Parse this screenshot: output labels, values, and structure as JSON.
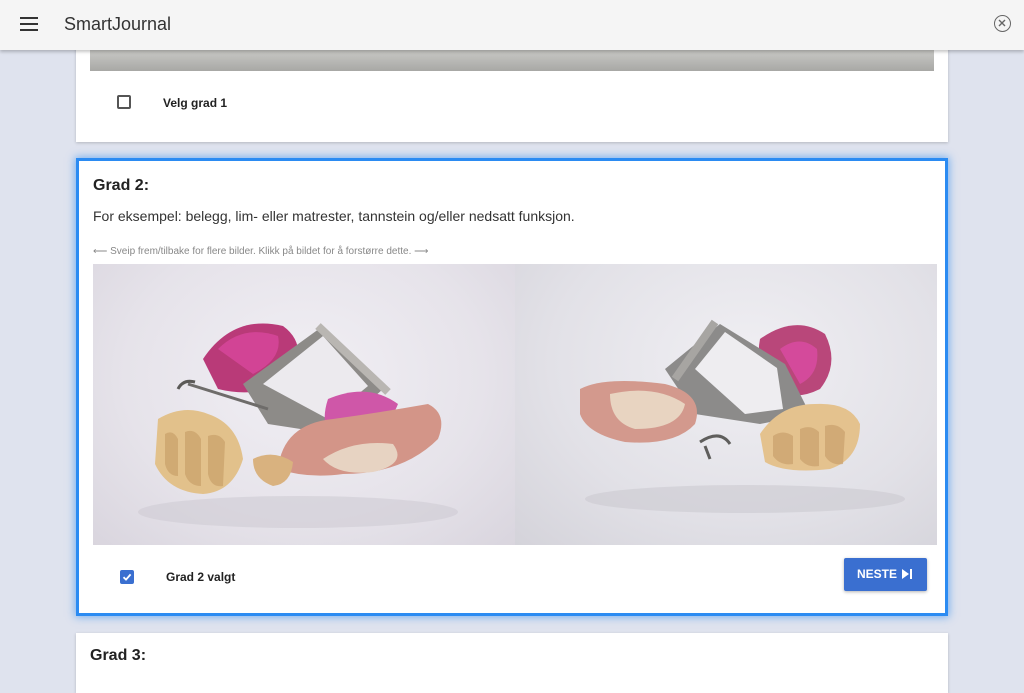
{
  "app": {
    "title": "SmartJournal"
  },
  "cards": [
    {
      "checkbox_label": "Velg grad 1",
      "checked": false
    },
    {
      "title": "Grad 2:",
      "description": "For eksempel: belegg, lim- eller matrester, tannstein og/eller nedsatt funksjon.",
      "swipe_hint": "⟵ Sveip frem/tilbake for flere bilder. Klikk på bildet for å forstørre dette. ⟶",
      "checkbox_label": "Grad 2 valgt",
      "checked": true,
      "next_label": "NESTE"
    },
    {
      "title": "Grad 3:"
    }
  ],
  "colors": {
    "accent": "#3a6fd0",
    "focus_border": "#2b8bf2",
    "background": "#dfe3ee",
    "appbar": "#f5f5f5"
  },
  "icons": {
    "menu": "menu-icon",
    "close": "close-circle-icon",
    "check": "check-icon",
    "next": "skip-next-icon"
  }
}
